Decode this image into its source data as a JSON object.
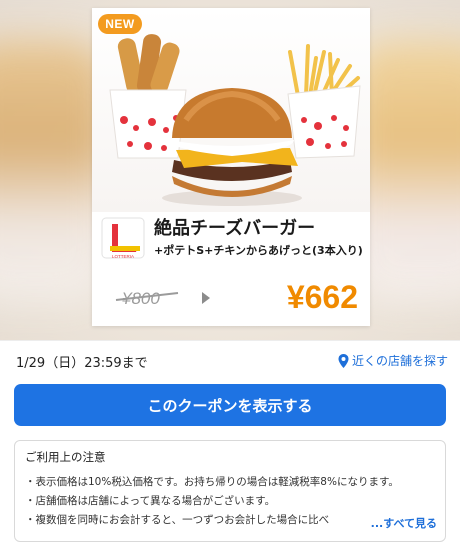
{
  "coupon": {
    "badge": "NEW",
    "product_name": "絶品チーズバーガー",
    "product_sub": "+ポテトS+チキンからあげっと(3本入り)",
    "old_price": "¥800",
    "new_price": "¥662",
    "brand": "LOTTERIA"
  },
  "expiry": {
    "text": "1/29（日）23:59まで"
  },
  "near_store": {
    "label": "近くの店舗を探す"
  },
  "actions": {
    "show_coupon_label": "このクーポンを表示する"
  },
  "notes": {
    "title": "ご利用上の注意",
    "items": [
      "・表示価格は10%税込価格です。お持ち帰りの場合は軽減税率8%になります。",
      "・店舗価格は店舗によって異なる場合がございます。",
      "・複数個を同時にお会計すると、一つずつお会計した場合に比べ"
    ],
    "see_all": "...すべて見る"
  },
  "colors": {
    "accent": "#1e73e3",
    "link": "#1e6fd9",
    "badge": "#f39b1f",
    "price": "#f08a00"
  }
}
